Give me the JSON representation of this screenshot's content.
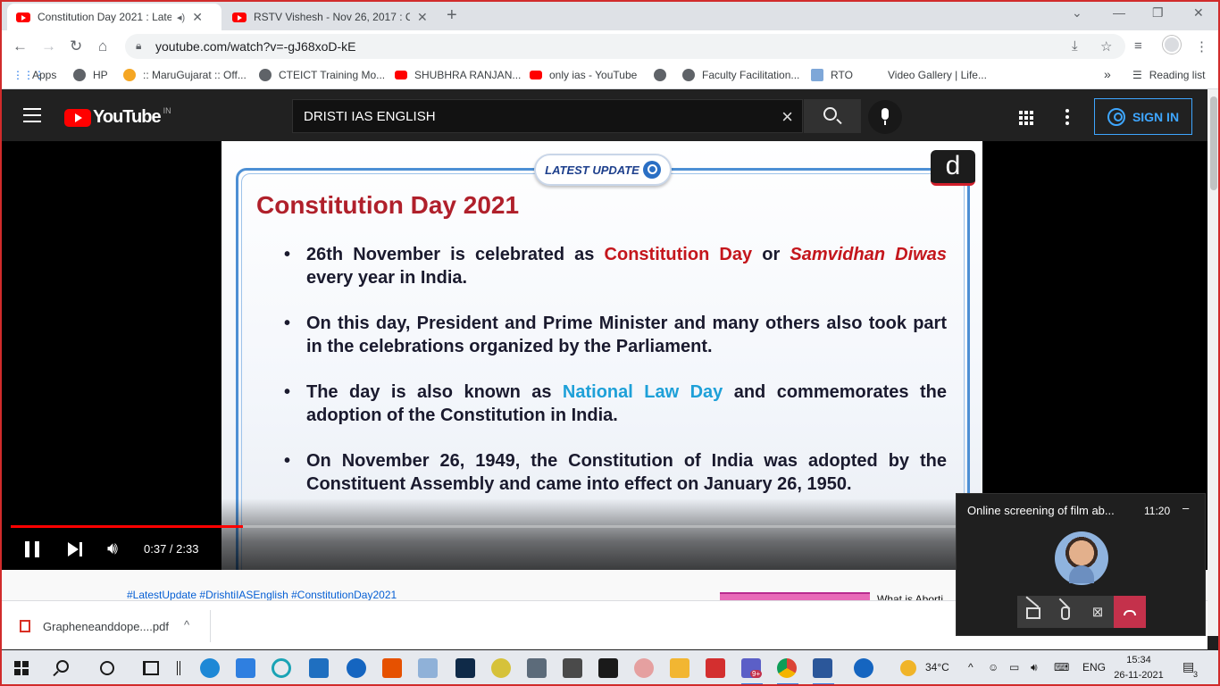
{
  "browser": {
    "tabs": [
      {
        "title": "Constitution Day 2021 : Late",
        "active": true
      },
      {
        "title": "RSTV Vishesh - Nov 26, 2017 : Co",
        "active": false
      }
    ],
    "url": "youtube.com/watch?v=-gJ68xoD-kE",
    "bookmarks": [
      "Apps",
      "HP",
      ":: MaruGujarat :: Off...",
      "CTEICT Training Mo...",
      "SHUBHRA RANJAN...",
      "only ias - YouTube",
      "Faculty Facilitation...",
      "RTO",
      "Video Gallery | Life..."
    ],
    "more": "»",
    "reading_list": "Reading list"
  },
  "youtube": {
    "logo": "YouTube",
    "country": "IN",
    "search_query": "DRISTI IAS ENGLISH",
    "signin": "SIGN IN"
  },
  "slide": {
    "badge": "LATEST UPDATE",
    "logo_letter": "d",
    "title": "Constitution Day 2021",
    "b1_a": "26th November is celebrated as ",
    "b1_red": "Constitution Day",
    "b1_or": " or ",
    "b1_italic": "Samvidhan Diwas",
    "b1_end": " every year in India.",
    "b2": "On this day, President and Prime Minister and many others also took part in the celebrations organized by the Parliament.",
    "b3_a": "The day is also known as ",
    "b3_blue": "National Law Day",
    "b3_end": " and commemorates the adoption of the Constitution in India.",
    "b4": "On November 26, 1949, the Constitution of India was adopted by the Constituent Assembly and came into effect on January 26, 1950."
  },
  "player": {
    "time": "0:37 / 2:33",
    "progress_fraction": 0.245
  },
  "below": {
    "hashtags": "#LatestUpdate #DrishtiIASEnglish #ConstitutionDay2021",
    "next_title": "What is Aborti"
  },
  "download": {
    "file": "Grapheneanddope....pdf"
  },
  "call": {
    "title": "Online screening of film ab...",
    "time": "11:20",
    "minimize": "–"
  },
  "taskbar": {
    "weather": "34°C",
    "lang": "ENG",
    "time": "15:34",
    "date": "26-11-2021",
    "notifications": "3",
    "teams_badge": "9+"
  }
}
